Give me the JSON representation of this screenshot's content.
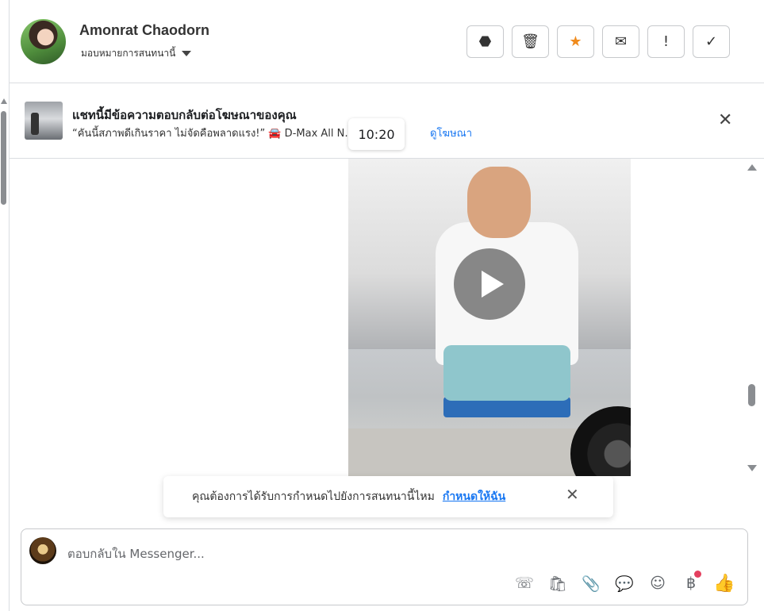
{
  "header": {
    "contact_name": "Amonrat Chaodorn",
    "assign_label": "มอบหมายการสนทนานี้",
    "actions": [
      {
        "name": "spam-button",
        "glyph": "⬣",
        "icon": "octagon-alert-icon"
      },
      {
        "name": "delete-button",
        "glyph": "🗑",
        "icon": "trash-icon"
      },
      {
        "name": "star-button",
        "glyph": "★",
        "icon": "star-icon"
      },
      {
        "name": "mark-unread-button",
        "glyph": "✉",
        "icon": "envelope-icon"
      },
      {
        "name": "follow-up-button",
        "glyph": "!",
        "icon": "exclamation-icon"
      },
      {
        "name": "mark-done-button",
        "glyph": "✓",
        "icon": "check-icon"
      }
    ]
  },
  "ad_banner": {
    "title": "แชทนี้มีข้อความตอบกลับต่อโฆษณาของคุณ",
    "subtitle": "“คันนี้สภาพดีเกินราคา ไม่จัดคือพลาดแรง!” 🚘 D-Max All N…",
    "link": "ดูโฆษณา",
    "close_glyph": "✕"
  },
  "message": {
    "timestamp": "10:20"
  },
  "assign_toast": {
    "text": "คุณต้องการได้รับการกำหนดไปยังการสนทนานี้ไหม",
    "link": "กำหนดให้ฉัน",
    "close_glyph": "✕"
  },
  "composer": {
    "placeholder": "ตอบกลับใน Messenger...",
    "tools": [
      {
        "name": "call-button",
        "glyph": "☏",
        "icon": "phone-plus-icon"
      },
      {
        "name": "shop-button",
        "glyph": "🛍",
        "icon": "bag-icon"
      },
      {
        "name": "attach-button",
        "glyph": "📎",
        "icon": "paperclip-icon"
      },
      {
        "name": "saved-replies-button",
        "glyph": "💬",
        "icon": "chat-bubble-icon"
      },
      {
        "name": "emoji-button",
        "glyph": "☺",
        "icon": "smiley-icon"
      },
      {
        "name": "payment-button",
        "glyph": "฿",
        "icon": "baht-icon"
      },
      {
        "name": "like-button",
        "glyph": "👍",
        "icon": "thumbs-up-icon"
      }
    ]
  },
  "colors": {
    "accent": "#1877f2",
    "star": "#f08b1d",
    "notification_dot": "#e4405f"
  }
}
